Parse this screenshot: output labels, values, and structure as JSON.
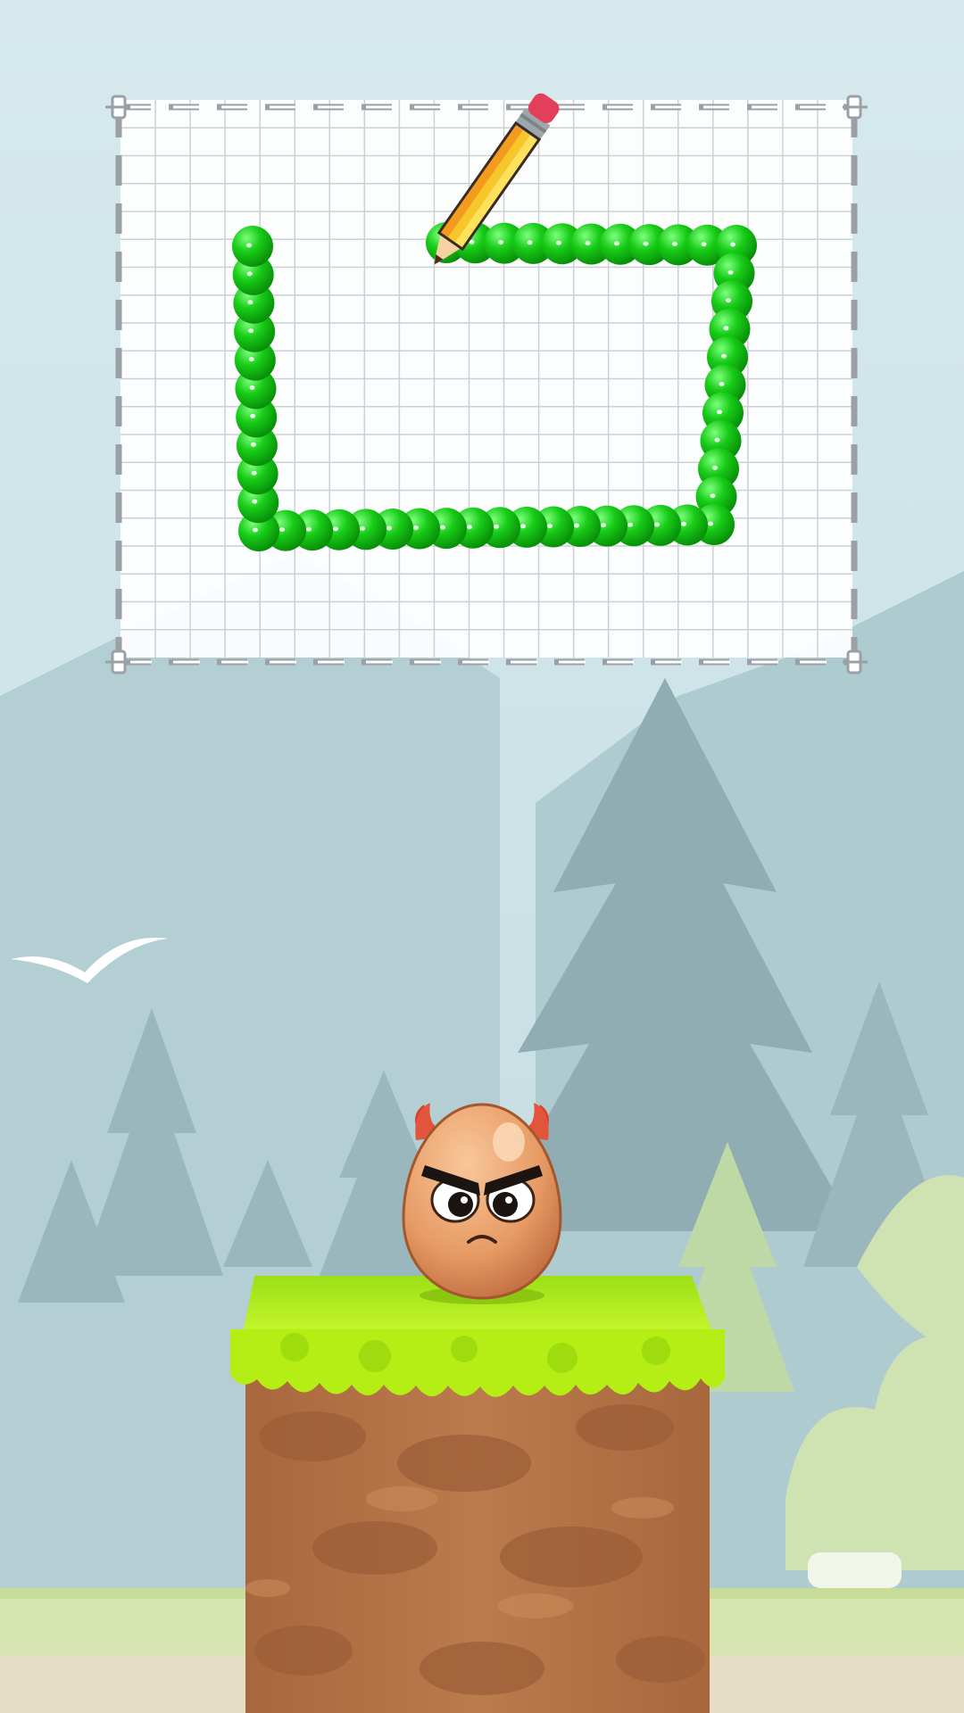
{
  "game": {
    "colors": {
      "sky_top": "#d3e8ec",
      "sky_bottom": "#bcd8dd",
      "mountain": "#a9c7cc",
      "far_tree": "#93b0b6",
      "tree_dark": "#7c9aa2",
      "grid_bg": "#ffffff",
      "grid_line": "#c9ced3",
      "ball_green": "#15c515",
      "ball_green_dark": "#0a8f0a",
      "grass_top": "#b6f01e",
      "grass_edge": "#9bdc0d",
      "dirt": "#b7764a",
      "dirt_dark": "#955a35",
      "egg": "#e9a06c",
      "horn": "#d6422c"
    },
    "drawing_area": {
      "grid_columns": 21,
      "grid_rows": 20
    },
    "drawn_path": {
      "color_name": "green",
      "shape": "open-rectangle-ball-chain"
    },
    "tool": {
      "icon": "pencil-icon"
    },
    "character": {
      "name": "angry-devil-egg",
      "mood": "angry"
    },
    "platform": {
      "type": "grass-dirt-block"
    },
    "background": {
      "scene": "misty-pine-forest",
      "bird": "white-seagull"
    }
  }
}
